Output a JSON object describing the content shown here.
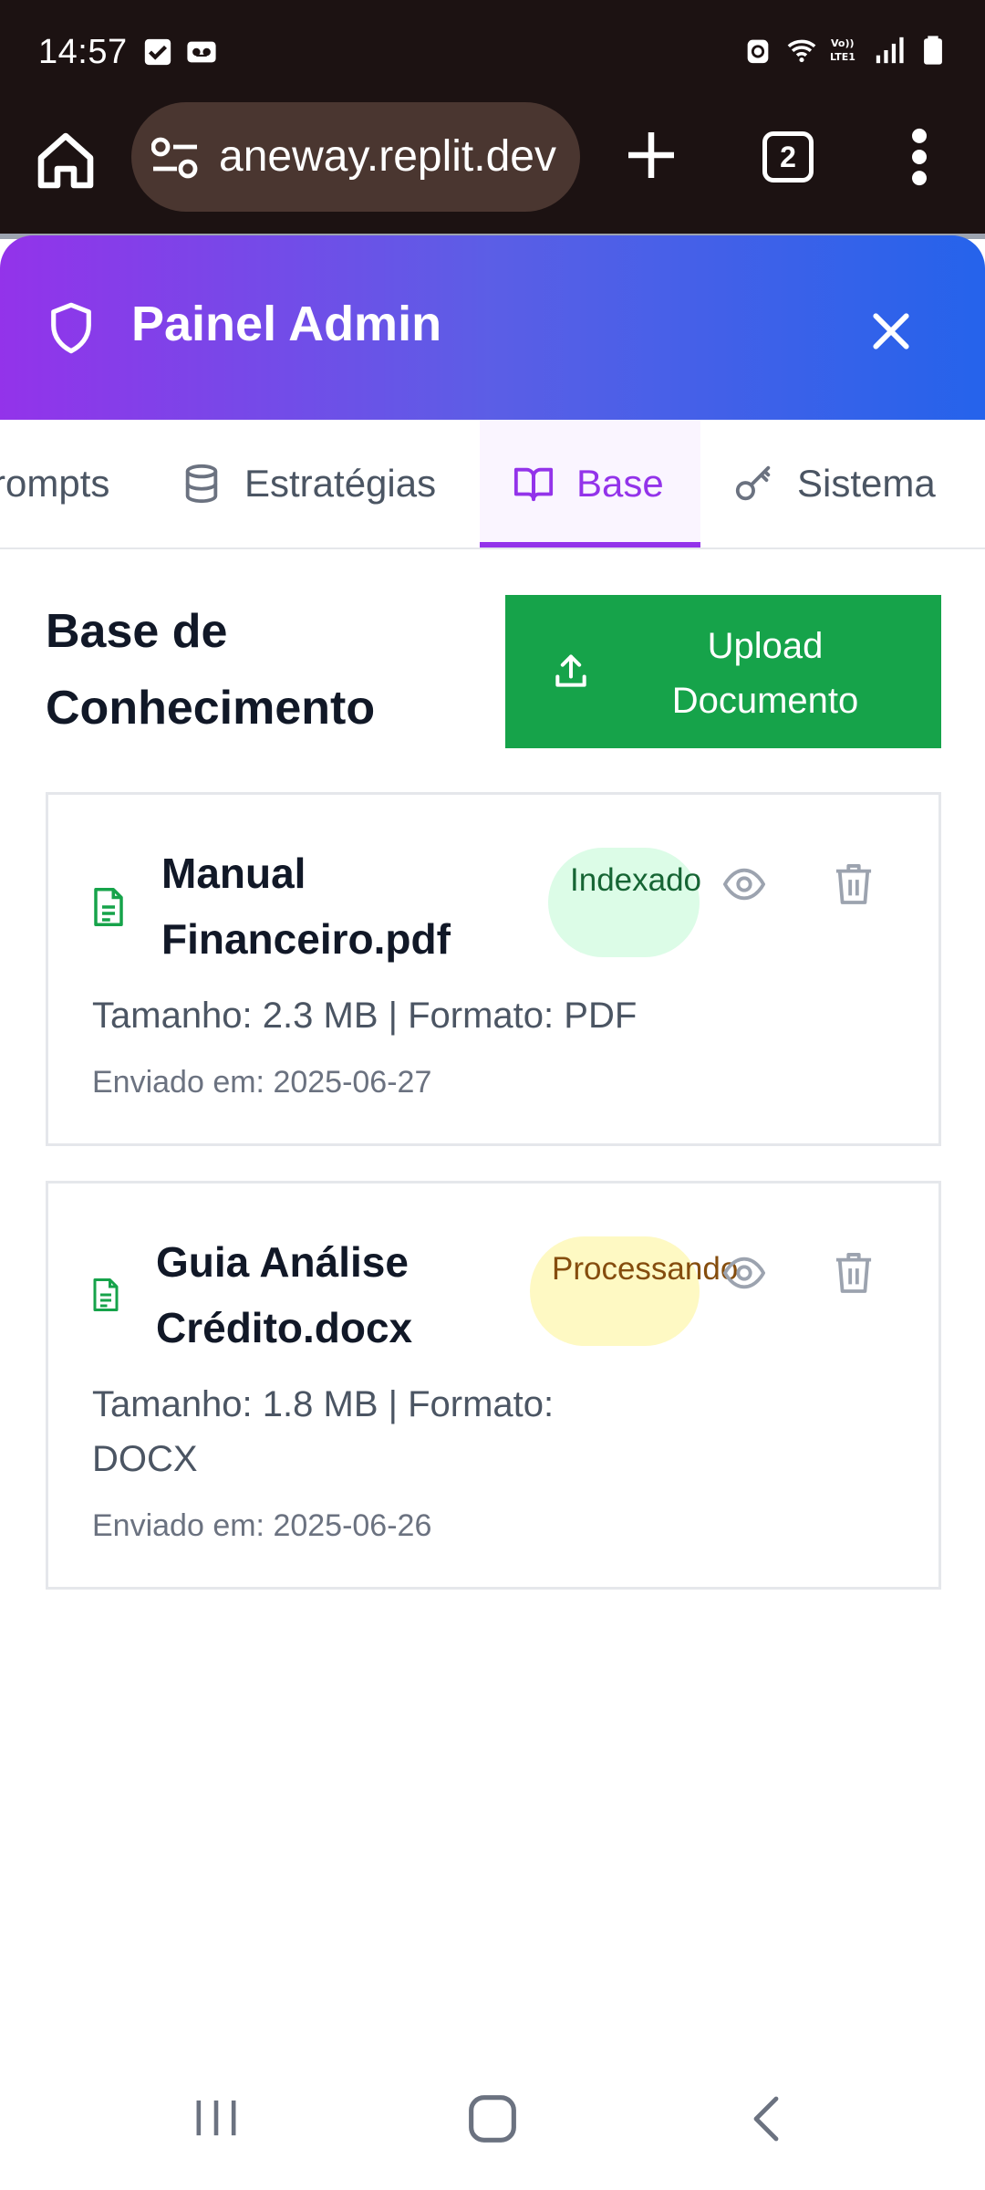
{
  "status_bar": {
    "time": "14:57",
    "icons": [
      "check-box-icon",
      "voicemail-icon",
      "android-icon",
      "wifi-icon",
      "volte-icon",
      "signal-icon",
      "battery-icon"
    ],
    "network_label": "Vo)) LTE1"
  },
  "browser": {
    "url": "aneway.replit.dev",
    "tab_count": "2"
  },
  "admin": {
    "title": "Painel Admin",
    "gradient": [
      "#9333ea",
      "#2563eb"
    ]
  },
  "tabs": [
    {
      "label": "rompts",
      "icon": "message-icon",
      "active": false
    },
    {
      "label": "Estratégias",
      "icon": "database-icon",
      "active": false
    },
    {
      "label": "Base",
      "icon": "book-icon",
      "active": true
    },
    {
      "label": "Sistema",
      "icon": "key-icon",
      "active": false
    }
  ],
  "section": {
    "title": "Base de Conhecimento",
    "upload_label": "Upload Documento",
    "upload_color": "#16a34a"
  },
  "documents": [
    {
      "name": "Manual Financeiro.pdf",
      "status": "Indexado",
      "status_color": "#dcfce7",
      "meta": "Tamanho: 2.3 MB | Formato: PDF",
      "date": "Enviado em: 2025-06-27"
    },
    {
      "name": "Guia Análise Crédito.docx",
      "status": "Processando",
      "status_color": "#fef9c3",
      "meta": "Tamanho: 1.8 MB | Formato: DOCX",
      "date": "Enviado em: 2025-06-26"
    }
  ]
}
